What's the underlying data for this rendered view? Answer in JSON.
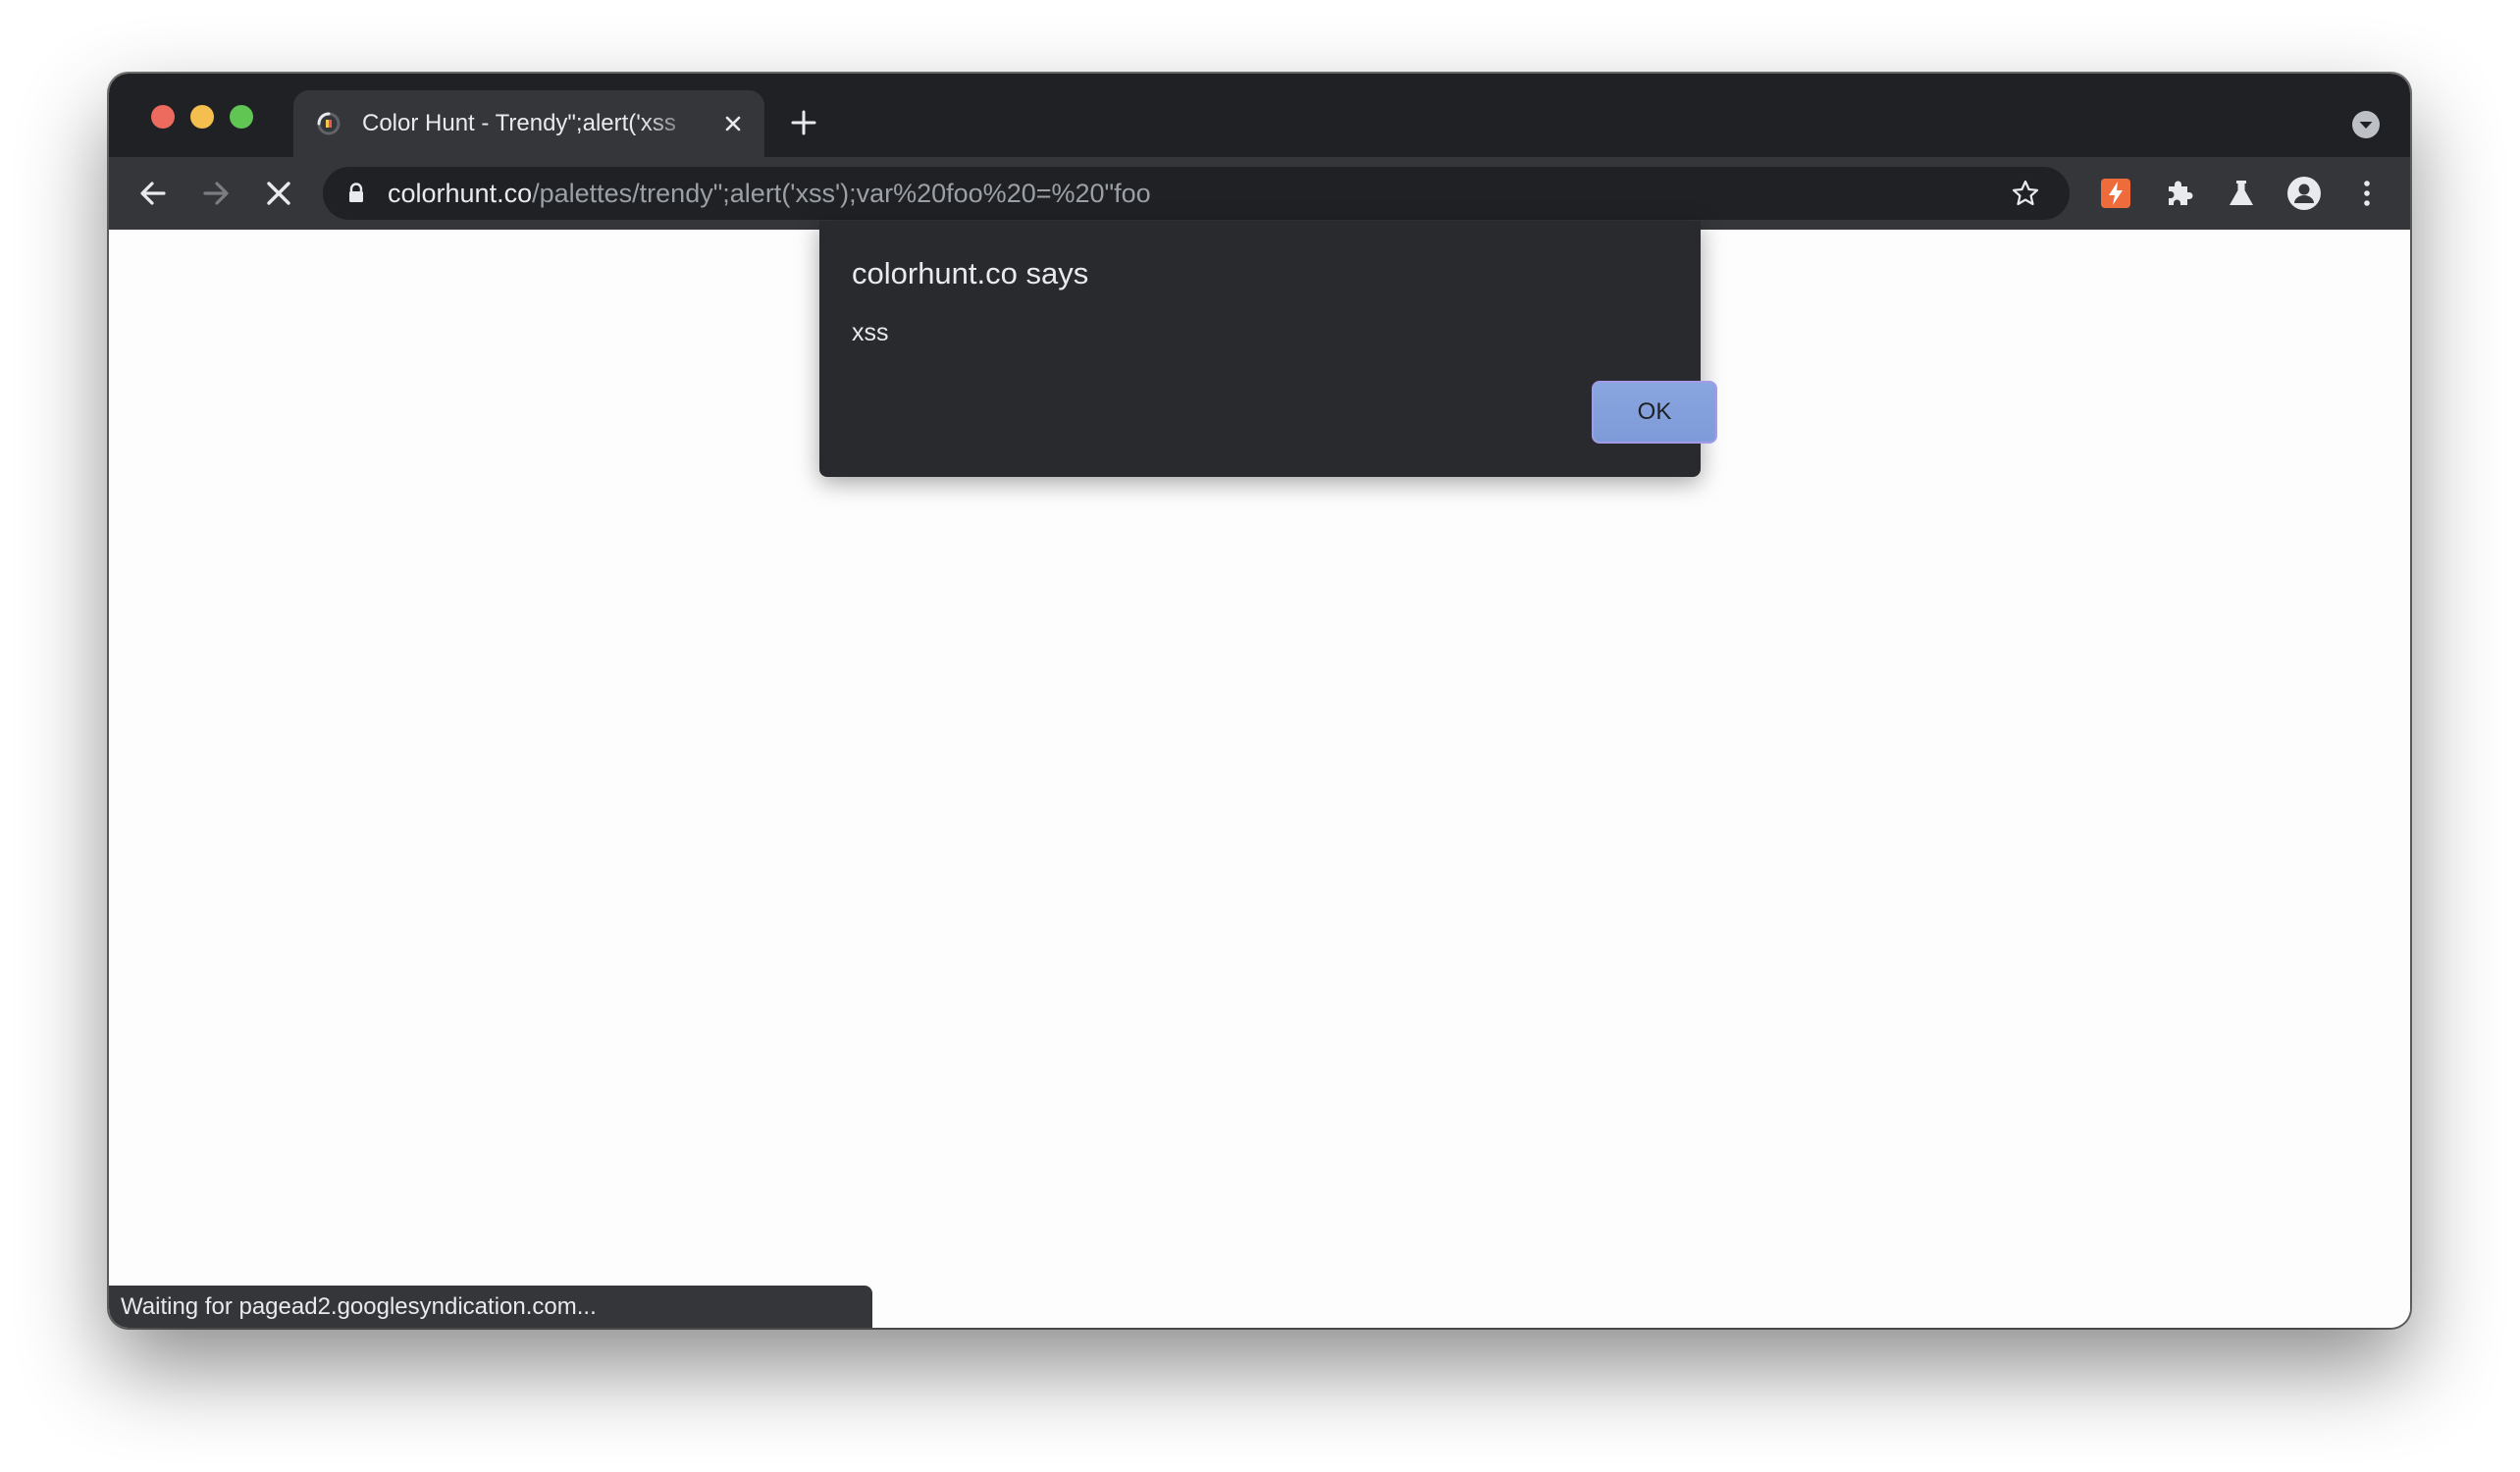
{
  "browser": {
    "tab": {
      "title": "Color Hunt - Trendy\";alert('xss"
    },
    "address_bar": {
      "host": "colorhunt.co",
      "path": "/palettes/trendy\";alert('xss');var%20foo%20=%20\"foo"
    },
    "icons": {
      "back": "back-arrow-icon",
      "forward": "forward-arrow-icon",
      "stop": "stop-loading-icon",
      "lock": "lock-icon",
      "bookmark": "star-icon",
      "extension_1": "lightning-extension-icon",
      "extensions": "puzzle-icon",
      "labs": "flask-icon",
      "profile": "profile-icon",
      "menu": "kebab-menu-icon",
      "new_tab": "plus-icon",
      "tab_search": "chevron-down-circle-icon",
      "tab_close": "close-icon"
    },
    "status_bar": "Waiting for pagead2.googlesyndication.com..."
  },
  "dialog": {
    "title": "colorhunt.co says",
    "message": "xss",
    "ok_label": "OK"
  },
  "colors": {
    "tab_strip": "#202124",
    "toolbar": "#35363a",
    "dialog_bg": "#292a2d",
    "ok_button": "#8aa6e0",
    "extension_accent": "#ee6b3c"
  }
}
